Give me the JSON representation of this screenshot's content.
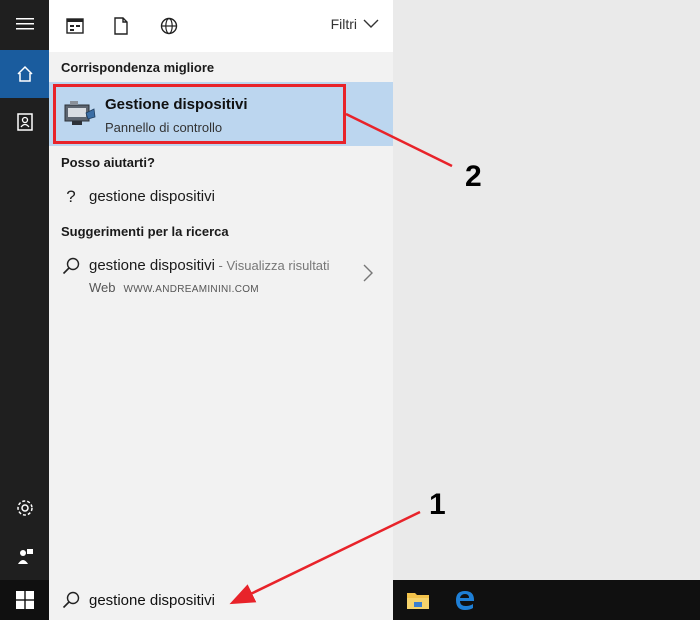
{
  "filters": {
    "label": "Filtri"
  },
  "best_match": {
    "section_title": "Corrispondenza migliore",
    "title": "Gestione dispositivi",
    "subtitle": "Pannello di controllo"
  },
  "help": {
    "section_title": "Posso aiutarti?",
    "item_text": "gestione dispositivi"
  },
  "suggestions": {
    "section_title": "Suggerimenti per la ricerca",
    "item_text": "gestione dispositivi",
    "item_hint": " - Visualizza risultati",
    "item_source": "Web",
    "watermark": "WWW.ANDREAMININI.COM"
  },
  "search": {
    "value": "gestione dispositivi"
  },
  "annotations": {
    "label_1": "1",
    "label_2": "2",
    "color": "#e8232a"
  },
  "colors": {
    "accent": "#1a5c9e",
    "highlight": "#bcd6ef",
    "rail": "#1f1f1f",
    "taskbar": "#101010"
  }
}
